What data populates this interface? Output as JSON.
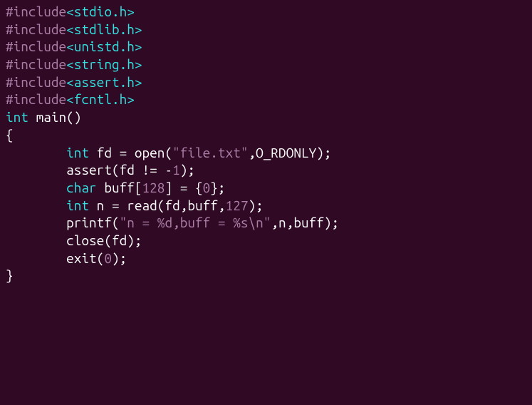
{
  "code": {
    "includes": [
      {
        "directive": "#include",
        "header": "<stdio.h>"
      },
      {
        "directive": "#include",
        "header": "<stdlib.h>"
      },
      {
        "directive": "#include",
        "header": "<unistd.h>"
      },
      {
        "directive": "#include",
        "header": "<string.h>"
      },
      {
        "directive": "#include",
        "header": "<assert.h>"
      },
      {
        "directive": "#include",
        "header": "<fcntl.h>"
      }
    ],
    "blank1": "",
    "main_decl": {
      "ret_type": "int",
      "name": "main",
      "parens": "()"
    },
    "open_brace": "{",
    "line1": {
      "indent": "        ",
      "type": "int",
      "var": " fd = open(",
      "str": "\"file.txt\"",
      "rest": ",O_RDONLY);"
    },
    "line2": {
      "indent": "        ",
      "text1": "assert(fd != -",
      "num": "1",
      "text2": ");"
    },
    "blank2": "",
    "line3": {
      "indent": "        ",
      "type": "char",
      "text1": " buff[",
      "num1": "128",
      "text2": "] = {",
      "num2": "0",
      "text3": "};"
    },
    "blank3": "",
    "line4": {
      "indent": "        ",
      "type": "int",
      "text1": " n = read(fd,buff,",
      "num": "127",
      "text2": ");"
    },
    "blank4": "",
    "line5": {
      "indent": "        ",
      "text1": "printf(",
      "str": "\"n = %d,buff = %s\\n\"",
      "text2": ",n,buff);"
    },
    "blank5": "",
    "line6": {
      "indent": "        ",
      "text": "close(fd);"
    },
    "line7": {
      "indent": "        ",
      "text1": "exit(",
      "num": "0",
      "text2": ");"
    },
    "close_brace": "}"
  }
}
